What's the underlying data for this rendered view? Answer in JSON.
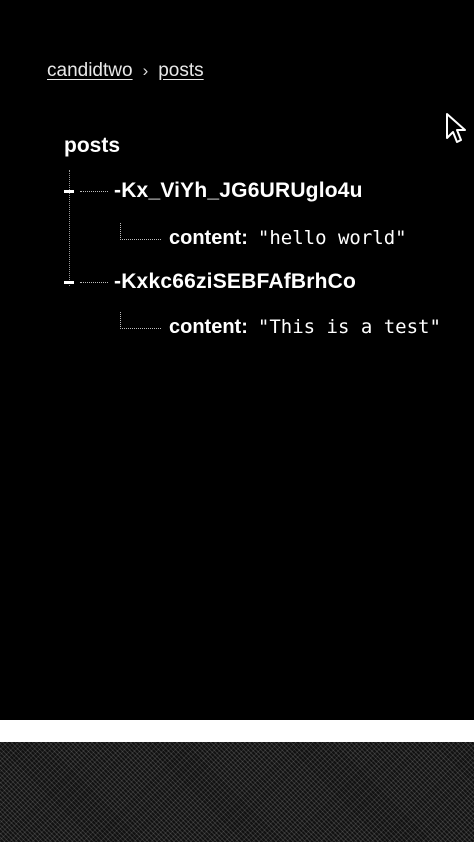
{
  "breadcrumb": {
    "root": "candidtwo",
    "separator": "›",
    "current": "posts"
  },
  "tree": {
    "root_label": "posts",
    "children": [
      {
        "key": "-Kx_ViYh_JG6URUglo4u",
        "field": "content",
        "value": "\"hello world\""
      },
      {
        "key": "-Kxkc66ziSEBFAfBrhCo",
        "field": "content",
        "value": "\"This is a test\""
      }
    ]
  },
  "icons": {
    "cursor": "mouse-pointer-icon",
    "toggle": "collapse-minus-icon"
  },
  "colors": {
    "background": "#000000",
    "text": "#ffffff"
  }
}
